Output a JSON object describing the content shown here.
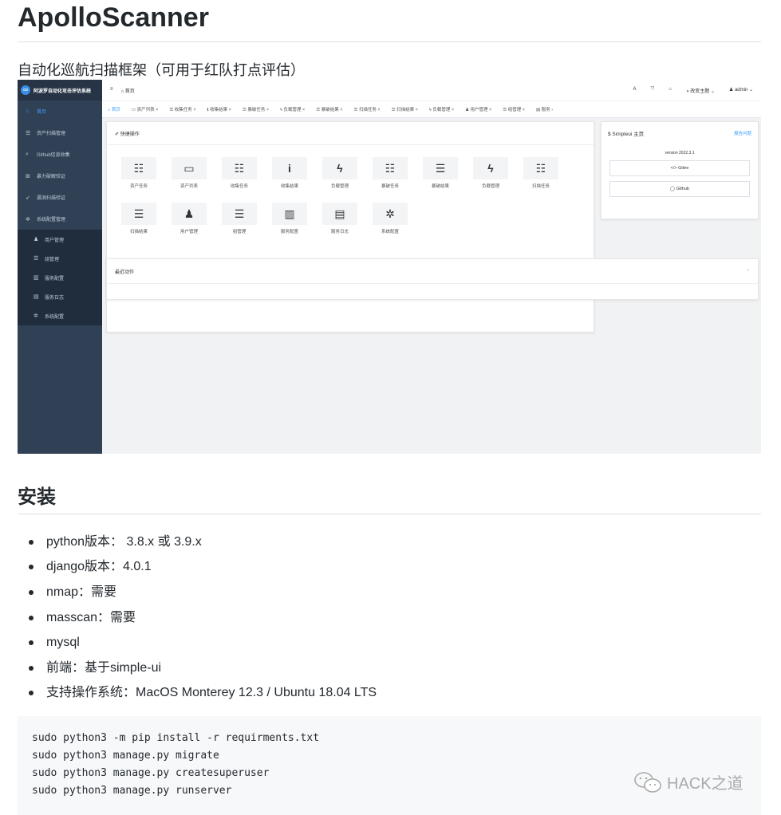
{
  "title": "ApolloScanner",
  "subtitle": "自动化巡航扫描框架（可用于红队打点评估）",
  "screenshot": {
    "sidebar": {
      "header": "阿波罗自动化攻击评估系统",
      "logo_text": "co",
      "items": [
        {
          "icon": "home-icon",
          "glyph": "⌂",
          "label": "首页",
          "active": true
        },
        {
          "icon": "list-icon",
          "glyph": "☰",
          "label": "资产扫描管理"
        },
        {
          "icon": "search-icon",
          "glyph": "⌕",
          "label": "Github信息收集"
        },
        {
          "icon": "bank-icon",
          "glyph": "⊞",
          "label": "暴力破解验证"
        },
        {
          "icon": "rocket-icon",
          "glyph": "➶",
          "label": "漏洞扫描验证"
        },
        {
          "icon": "gear-icon",
          "glyph": "✲",
          "label": "系统配置管理"
        }
      ],
      "sub_items": [
        {
          "icon": "user-icon",
          "glyph": "♟",
          "label": "用户管理"
        },
        {
          "icon": "list-icon",
          "glyph": "☰",
          "label": "组管理"
        },
        {
          "icon": "map-icon",
          "glyph": "▥",
          "label": "服务配置"
        },
        {
          "icon": "file-icon",
          "glyph": "▤",
          "label": "服务日志"
        },
        {
          "icon": "gear-icon",
          "glyph": "✲",
          "label": "系统配置"
        }
      ]
    },
    "topbar": {
      "menu_glyph": "≡",
      "breadcrumb": "⌂ 首页",
      "right_items": [
        "A",
        "⤧",
        "⌂",
        "◑ 改变主题 ⌄",
        "♟ admin ⌄"
      ]
    },
    "tabs": [
      "⌂ 首页",
      "▭ 资产列表 ×",
      "☰ 收集任务 ×",
      "ℹ 收集结果 ×",
      "☰ 暴破任务 ×",
      "ϟ 负载管理 ×",
      "☰ 暴破结果 ×",
      "☰ 扫描任务 ×",
      "☰ 扫描结果 ×",
      "ϟ 负载管理 ×",
      "♟ 用户管理 ×",
      "☰ 组管理 ×",
      "▤ 服务 ›"
    ],
    "quick_actions": {
      "header": "✐ 快捷操作",
      "items": [
        {
          "icon": "checklist-icon",
          "glyph": "☷",
          "label": "资产任务"
        },
        {
          "icon": "monitor-icon",
          "glyph": "▭",
          "label": "资产列表"
        },
        {
          "icon": "checklist-icon",
          "glyph": "☷",
          "label": "收集任务"
        },
        {
          "icon": "info-icon",
          "glyph": "i",
          "label": "收集结果"
        },
        {
          "icon": "bolt-icon",
          "glyph": "ϟ",
          "label": "负载管理"
        },
        {
          "icon": "checklist-icon",
          "glyph": "☷",
          "label": "暴破任务"
        },
        {
          "icon": "server-icon",
          "glyph": "☰",
          "label": "暴破结果"
        },
        {
          "icon": "bolt-icon",
          "glyph": "ϟ",
          "label": "负载管理"
        },
        {
          "icon": "checklist-icon",
          "glyph": "☷",
          "label": "扫描任务"
        },
        {
          "icon": "server-icon",
          "glyph": "☰",
          "label": "扫描结果"
        },
        {
          "icon": "user-icon",
          "glyph": "♟",
          "label": "用户管理"
        },
        {
          "icon": "list-icon",
          "glyph": "☰",
          "label": "组管理"
        },
        {
          "icon": "map-icon",
          "glyph": "▥",
          "label": "服务配置"
        },
        {
          "icon": "file-icon",
          "glyph": "▤",
          "label": "服务日志"
        },
        {
          "icon": "gear-icon",
          "glyph": "✲",
          "label": "系统配置"
        }
      ]
    },
    "simpleui": {
      "title": "$ Simpleui 主页",
      "report": "报告问题",
      "version": "version 2022.3.1",
      "gitee": "</> Gitee",
      "github": "◯ Github"
    },
    "recent": {
      "title": "最近动作",
      "toggle": "⌃"
    }
  },
  "install": {
    "heading": "安装",
    "items": [
      "python版本： 3.8.x 或 3.9.x",
      "django版本：4.0.1",
      "nmap：需要",
      "masscan：需要",
      "mysql",
      "前端：基于simple-ui",
      "支持操作系统：MacOS Monterey 12.3 / Ubuntu 18.04 LTS"
    ],
    "code": [
      "sudo python3 -m pip install -r requirments.txt",
      "sudo python3 manage.py migrate",
      "sudo python3 manage.py createsuperuser",
      "sudo python3 manage.py runserver"
    ]
  },
  "watermark": "HACK之道"
}
